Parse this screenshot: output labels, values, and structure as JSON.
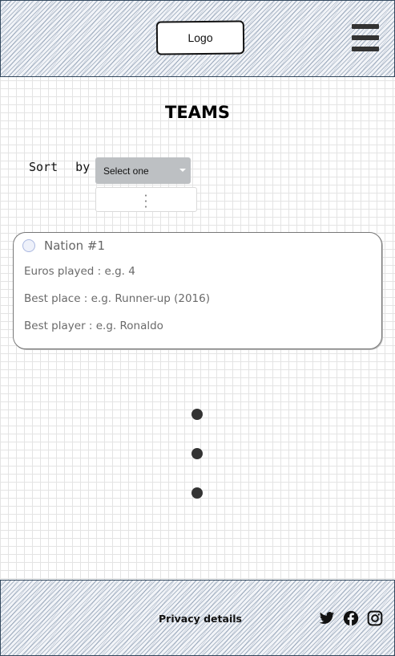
{
  "header": {
    "logo": "Logo",
    "menu_icon": "hamburger-icon"
  },
  "page": {
    "title": "TEAMS"
  },
  "sort": {
    "label": "Sort  by",
    "selected": "Select one",
    "caret_icon": "caret-down-icon",
    "list_icon": "vertical-dots-icon"
  },
  "team_card": {
    "radio_icon": "radio-icon",
    "title": "Nation #1",
    "euros_played": "Euros played : e.g. 4",
    "best_place": "Best place : e.g. Runner-up (2016)",
    "best_player": "Best player : e.g. Ronaldo"
  },
  "more_indicator_icon": "ellipsis-vertical-icon",
  "footer": {
    "privacy": "Privacy details",
    "social": [
      {
        "name": "twitter-icon"
      },
      {
        "name": "facebook-icon"
      },
      {
        "name": "instagram-icon"
      }
    ]
  },
  "colors": {
    "border": "#34495e",
    "select_bg": "#bdc0c3",
    "text_dark": "#111111",
    "text_muted": "#6a6a6a",
    "dot": "#333333"
  }
}
